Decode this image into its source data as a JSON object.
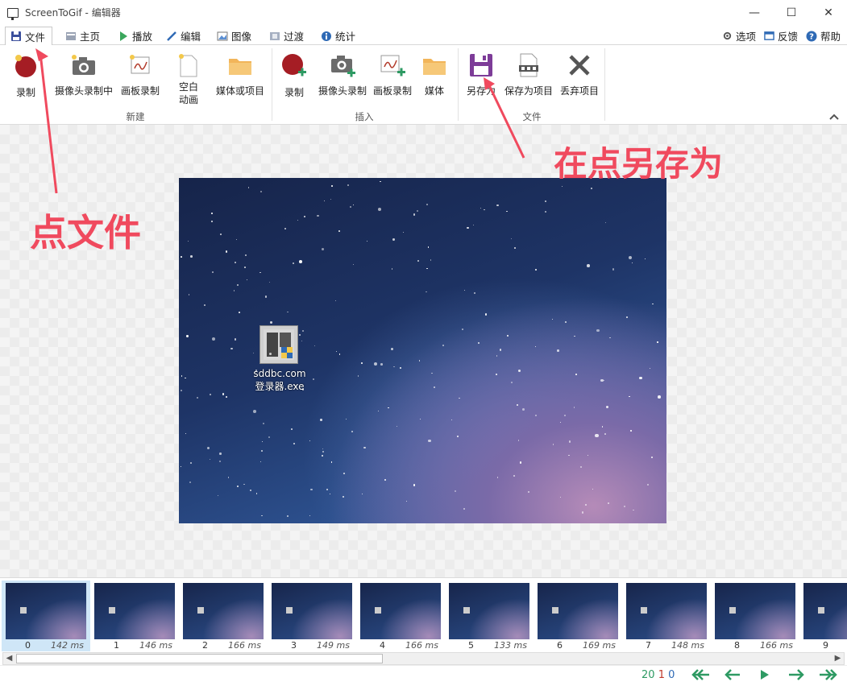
{
  "window": {
    "title": "ScreenToGif - 编辑器",
    "controls": [
      "—",
      "☐",
      "✕"
    ]
  },
  "tabs": [
    {
      "label": "文件",
      "active": true
    },
    {
      "label": "主页"
    },
    {
      "label": "播放"
    },
    {
      "label": "编辑"
    },
    {
      "label": "图像"
    },
    {
      "label": "过渡"
    },
    {
      "label": "统计"
    }
  ],
  "top_right": {
    "options": "选项",
    "feedback": "反馈",
    "help": "帮助"
  },
  "ribbon": {
    "groups": [
      {
        "label": "新建",
        "buttons": [
          "录制",
          "摄像头录制中",
          "画板录制",
          "空白\n动画",
          "媒体或项目"
        ]
      },
      {
        "label": "插入",
        "buttons": [
          "录制",
          "摄像头录制",
          "画板录制",
          "媒体"
        ]
      },
      {
        "label": "文件",
        "buttons": [
          "另存为",
          "保存为项目",
          "丢弃项目"
        ]
      }
    ]
  },
  "canvas": {
    "desktop_icon_label_line1": "sddbc.com",
    "desktop_icon_label_line2": "登录器.exe"
  },
  "annotations": {
    "click_file": "点文件",
    "then_save_as": "在点另存为"
  },
  "frames": [
    {
      "index": "0",
      "ms": "142 ms",
      "selected": true
    },
    {
      "index": "1",
      "ms": "146 ms"
    },
    {
      "index": "2",
      "ms": "166 ms"
    },
    {
      "index": "3",
      "ms": "149 ms"
    },
    {
      "index": "4",
      "ms": "166 ms"
    },
    {
      "index": "5",
      "ms": "133 ms"
    },
    {
      "index": "6",
      "ms": "169 ms"
    },
    {
      "index": "7",
      "ms": "148 ms"
    },
    {
      "index": "8",
      "ms": "166 ms"
    },
    {
      "index": "9",
      "ms": ""
    }
  ],
  "status": {
    "total_frames": "20",
    "selected_frames": "1",
    "current_frame": "0"
  },
  "colors": {
    "accent_annotation": "#f04a5e",
    "nav_green": "#2e9a63"
  }
}
